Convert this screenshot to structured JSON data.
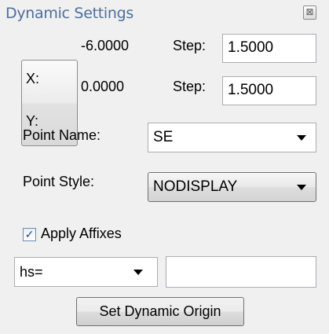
{
  "window": {
    "title": "Dynamic Settings",
    "close_glyph": "⊠"
  },
  "coords": {
    "x_label": "X:",
    "x_value": "-6.0000",
    "y_label": "Y:",
    "y_value": "0.0000",
    "step_label": "Step:",
    "x_step": "1.5000",
    "y_step": "1.5000"
  },
  "point_name": {
    "label": "Point Name:",
    "value": "SE"
  },
  "point_style": {
    "label": "Point Style:",
    "value": "NODISPLAY"
  },
  "affixes": {
    "label": "Apply Affixes",
    "checked": true,
    "check_glyph": "✓",
    "select_value": "hs=",
    "text_value": ""
  },
  "actions": {
    "set_origin_label": "Set Dynamic Origin"
  }
}
